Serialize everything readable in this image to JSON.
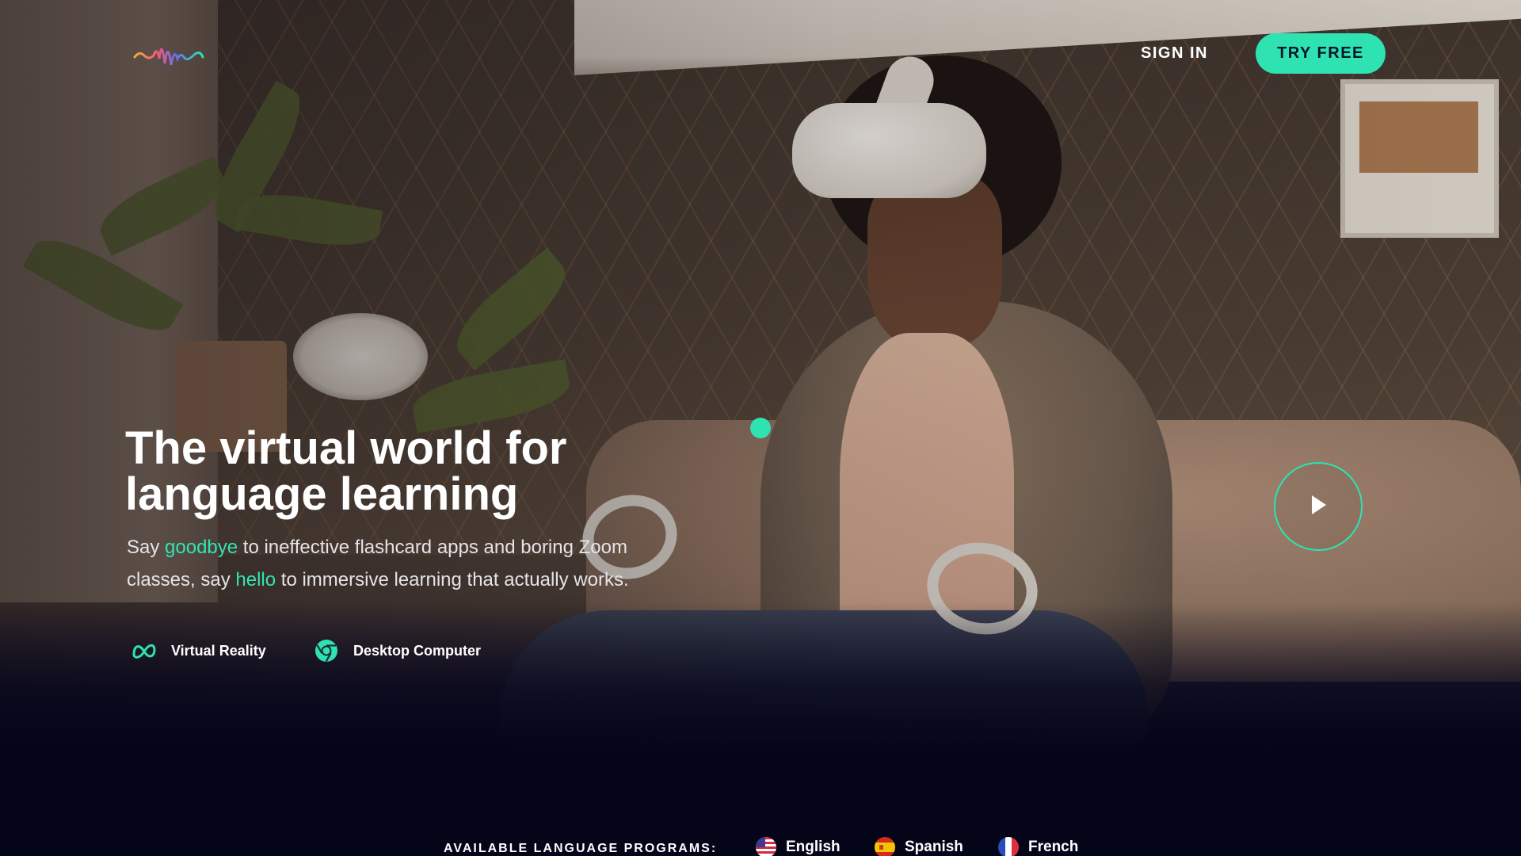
{
  "header": {
    "sign_in_label": "SIGN IN",
    "try_free_label": "TRY FREE"
  },
  "hero": {
    "headline_line1": "The virtual world for",
    "headline_line2": "language learning",
    "subline": {
      "part1": "Say ",
      "highlight1": "goodbye",
      "part2": " to ineffective flashcard apps and boring Zoom classes, say ",
      "highlight2": "hello",
      "part3": " to immersive learning that actually works."
    },
    "platforms": [
      {
        "label": "Virtual Reality",
        "icon": "meta-icon"
      },
      {
        "label": "Desktop Computer",
        "icon": "chrome-icon"
      }
    ]
  },
  "languages": {
    "label": "AVAILABLE LANGUAGE PROGRAMS:",
    "items": [
      {
        "label": "English",
        "icon": "us-flag-icon"
      },
      {
        "label": "Spanish",
        "icon": "spain-flag-icon"
      },
      {
        "label": "French",
        "icon": "france-flag-icon"
      }
    ]
  },
  "colors": {
    "accent": "#2ee2b1",
    "background": "#05051a",
    "text": "#ffffff"
  }
}
